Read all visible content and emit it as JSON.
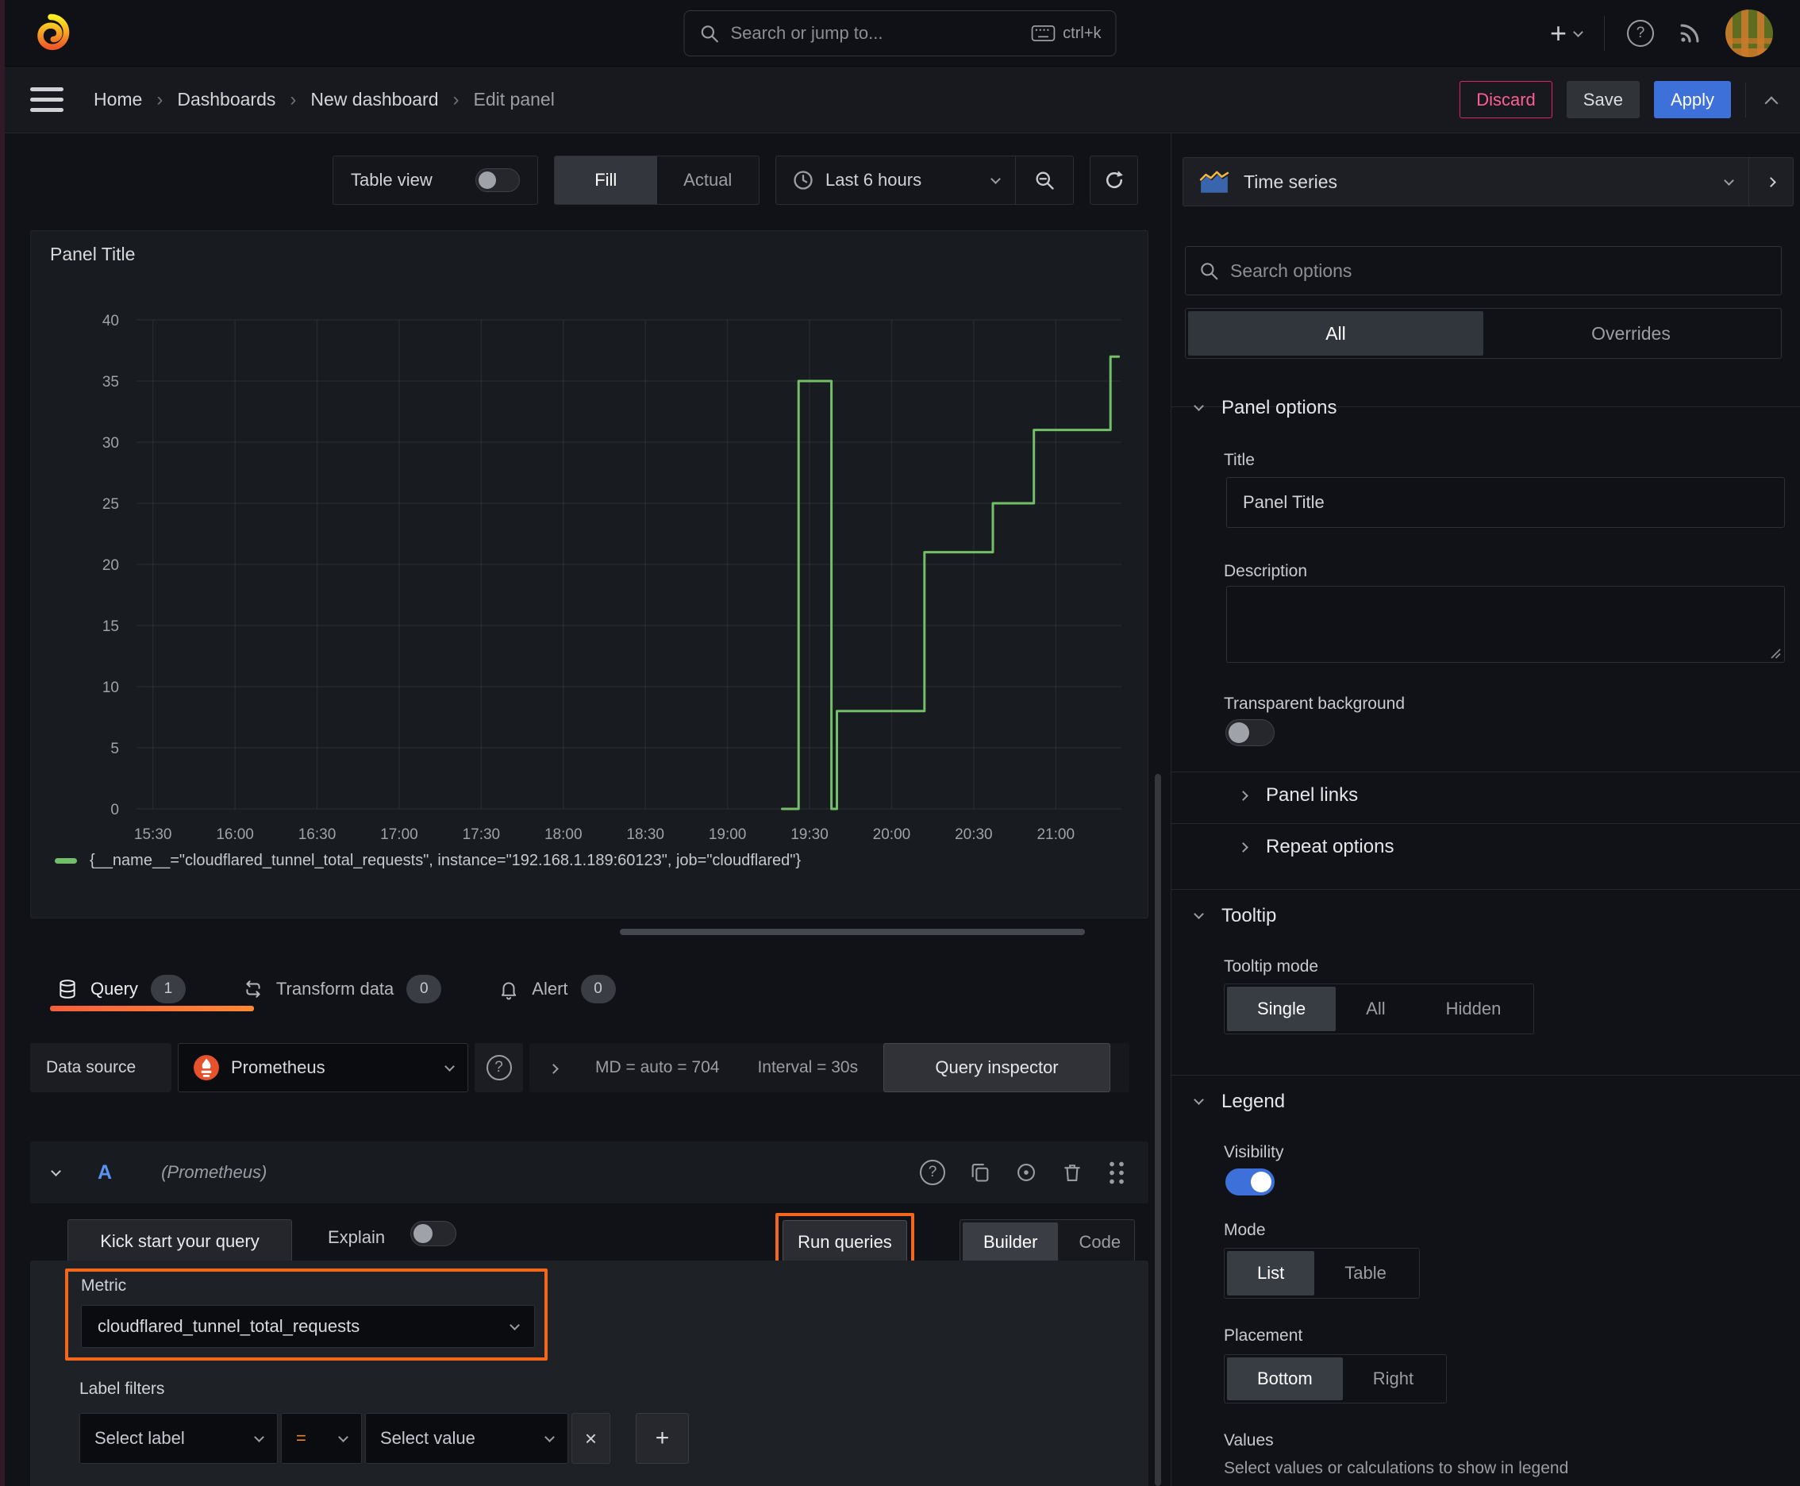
{
  "topnav": {
    "search_placeholder": "Search or jump to...",
    "shortcut": "ctrl+k"
  },
  "breadcrumb": {
    "items": [
      "Home",
      "Dashboards",
      "New dashboard",
      "Edit panel"
    ]
  },
  "actions": {
    "discard": "Discard",
    "save": "Save",
    "apply": "Apply"
  },
  "toolbar": {
    "table_view": "Table view",
    "fill": "Fill",
    "actual": "Actual",
    "time_range": "Last 6 hours"
  },
  "viz_picker": {
    "label": "Time series"
  },
  "panel": {
    "title": "Panel Title"
  },
  "chart_data": {
    "type": "line",
    "title": "Panel Title",
    "xlabel": "",
    "ylabel": "",
    "x_unit": "minutes_of_day",
    "xlim": [
      924,
      1284
    ],
    "ylim": [
      0,
      40
    ],
    "grid": true,
    "legend_position": "bottom",
    "y_ticks": [
      0,
      5,
      10,
      15,
      20,
      25,
      30,
      35,
      40
    ],
    "x_ticks": [
      {
        "m": 930,
        "label": "15:30"
      },
      {
        "m": 960,
        "label": "16:00"
      },
      {
        "m": 990,
        "label": "16:30"
      },
      {
        "m": 1020,
        "label": "17:00"
      },
      {
        "m": 1050,
        "label": "17:30"
      },
      {
        "m": 1080,
        "label": "18:00"
      },
      {
        "m": 1110,
        "label": "18:30"
      },
      {
        "m": 1140,
        "label": "19:00"
      },
      {
        "m": 1170,
        "label": "19:30"
      },
      {
        "m": 1200,
        "label": "20:00"
      },
      {
        "m": 1230,
        "label": "20:30"
      },
      {
        "m": 1260,
        "label": "21:00"
      }
    ],
    "series": [
      {
        "name": "{__name__=\"cloudflared_tunnel_total_requests\", instance=\"192.168.1.189:60123\", job=\"cloudflared\"}",
        "color": "#73BF69",
        "points": [
          [
            1160,
            0
          ],
          [
            1166,
            0
          ],
          [
            1166,
            35
          ],
          [
            1178,
            35
          ],
          [
            1178,
            0
          ],
          [
            1180,
            0
          ],
          [
            1180,
            8
          ],
          [
            1212,
            8
          ],
          [
            1212,
            21
          ],
          [
            1237,
            21
          ],
          [
            1237,
            25
          ],
          [
            1252,
            25
          ],
          [
            1252,
            31
          ],
          [
            1280,
            31
          ],
          [
            1280,
            37
          ],
          [
            1283,
            37
          ]
        ]
      }
    ]
  },
  "tabs": {
    "query": {
      "label": "Query",
      "count": "1"
    },
    "transform": {
      "label": "Transform data",
      "count": "0"
    },
    "alert": {
      "label": "Alert",
      "count": "0"
    }
  },
  "query": {
    "datasource_label": "Data source",
    "datasource_value": "Prometheus",
    "stats": {
      "md": "MD = auto = 704",
      "interval": "Interval = 30s"
    },
    "inspector": "Query inspector",
    "ref_id": "A",
    "ref_ds": "(Prometheus)",
    "kick_start": "Kick start your query",
    "explain": "Explain",
    "run_queries": "Run queries",
    "builder": "Builder",
    "code": "Code",
    "metric_label": "Metric",
    "metric_value": "cloudflared_tunnel_total_requests",
    "label_filters": "Label filters",
    "select_label": "Select label",
    "operator": "=",
    "select_value": "Select value"
  },
  "sidebar": {
    "search_placeholder": "Search options",
    "tabs": {
      "all": "All",
      "overrides": "Overrides"
    },
    "panel_options": {
      "title": "Panel options",
      "title_label": "Title",
      "title_value": "Panel Title",
      "description_label": "Description",
      "transparent_label": "Transparent background"
    },
    "collapsed": {
      "panel_links": "Panel links",
      "repeat_options": "Repeat options"
    },
    "tooltip": {
      "title": "Tooltip",
      "mode_label": "Tooltip mode",
      "options": [
        "Single",
        "All",
        "Hidden"
      ]
    },
    "legend": {
      "title": "Legend",
      "visibility_label": "Visibility",
      "mode_label": "Mode",
      "mode_options": [
        "List",
        "Table"
      ],
      "placement_label": "Placement",
      "placement_options": [
        "Bottom",
        "Right"
      ],
      "values_label": "Values",
      "values_help": "Select values or calculations to show in legend"
    }
  },
  "icons": {
    "plus": "+",
    "remove": "×",
    "help": "?"
  },
  "colors": {
    "series_green": "#73BF69",
    "accent_orange": "#F2671C",
    "tab_underline_start": "#F55F3C",
    "tab_underline_end": "#FF8833",
    "apply_blue": "#3D71D9",
    "discard_pink": "#E0226E",
    "toggle_on_blue": "#3D71D9",
    "operator_orange": "#E8822E",
    "ref_id_blue": "#5B93F2"
  }
}
